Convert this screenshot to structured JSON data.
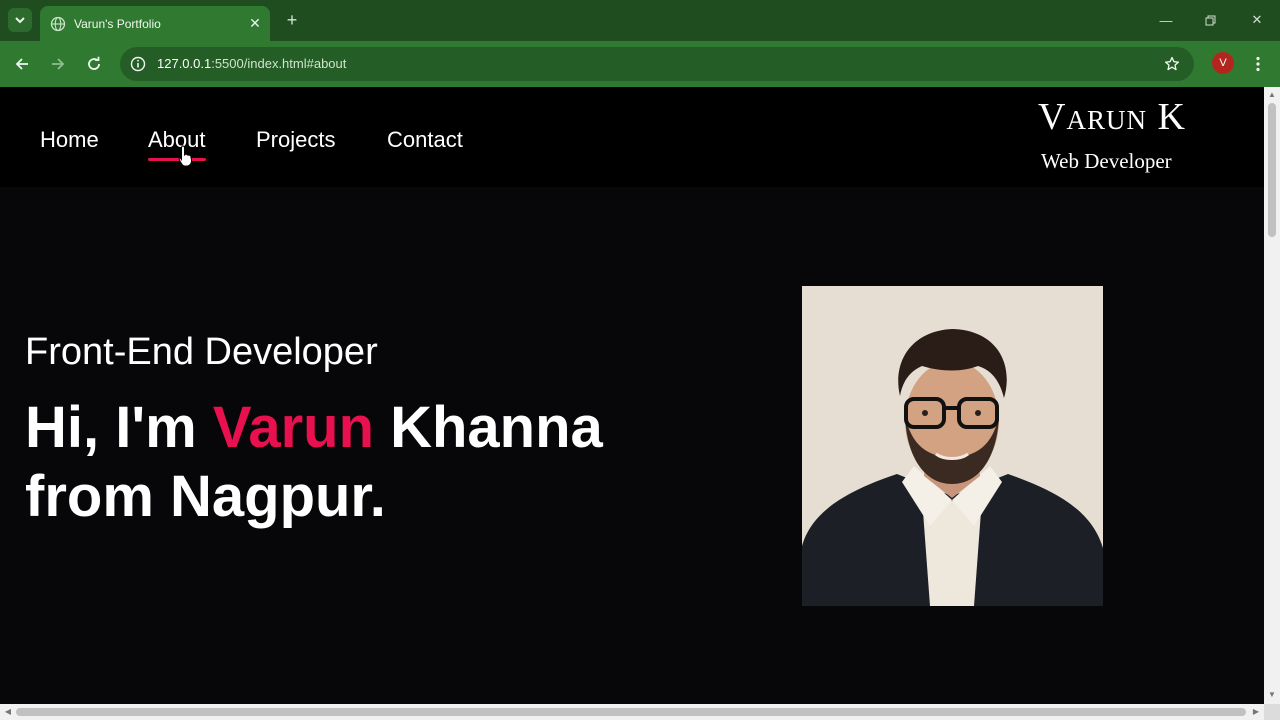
{
  "browser": {
    "tab_title": "Varun's Portfolio",
    "url_host": "127.0.0.1",
    "url_rest": ":5500/index.html#about",
    "profile_initial": "V",
    "accent_color": "#2f7a30"
  },
  "site": {
    "nav": [
      {
        "label": "Home"
      },
      {
        "label": "About",
        "active": true
      },
      {
        "label": "Projects"
      },
      {
        "label": "Contact"
      }
    ],
    "brand_name": "Varun K",
    "brand_role": "Web Developer",
    "subtitle": "Front-End Developer",
    "headline_prefix": "Hi, I'm ",
    "headline_accent": "Varun",
    "headline_suffix": " Khanna",
    "headline_line2": "from Nagpur.",
    "accent_color": "#e8104f"
  },
  "icons": {
    "tab_search": "chevron-down-icon",
    "favicon": "globe-icon",
    "tab_close": "close-icon",
    "new_tab": "plus-icon",
    "back": "arrow-left-icon",
    "forward": "arrow-right-icon",
    "reload": "reload-icon",
    "site_info": "info-icon",
    "bookmark": "star-icon",
    "menu": "kebab-icon",
    "minimize": "minimize-icon",
    "restore": "restore-icon",
    "close_window": "close-icon"
  }
}
